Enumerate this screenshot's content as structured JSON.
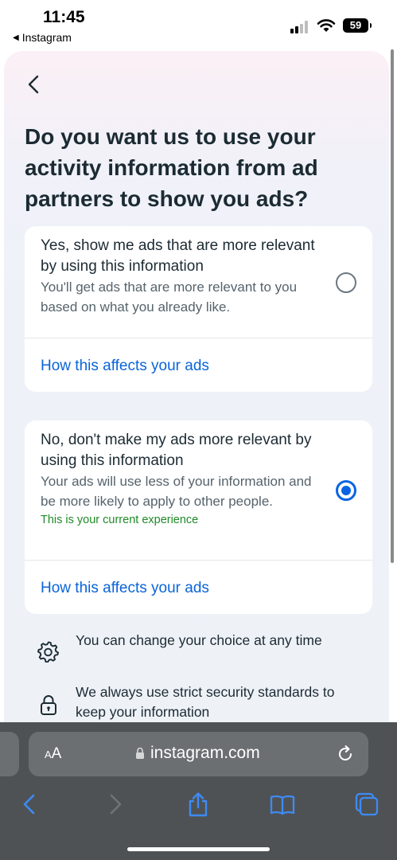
{
  "status_bar": {
    "time": "11:45",
    "back_app": "Instagram",
    "back_arrow": "◀",
    "battery": "59"
  },
  "page": {
    "title": "Do you want us to use your activity information from ad partners to show you ads?",
    "options": [
      {
        "title": "Yes, show me ads that are more relevant by using this information",
        "description": "You'll get ads that are more relevant to you based on what you already like.",
        "selected": false,
        "link": "How this affects your ads"
      },
      {
        "title": "No, don't make my ads more relevant by using this information",
        "description": "Your ads will use less of your information and be more likely to apply to other people.",
        "current_note": "This is your current experience",
        "selected": true,
        "link": "How this affects your ads"
      }
    ],
    "info": [
      {
        "icon": "gear-icon",
        "text": "You can change your choice at any time"
      },
      {
        "icon": "lock-icon",
        "text": "We always use strict security standards to keep your information"
      }
    ]
  },
  "browser": {
    "text_size_label_small": "A",
    "text_size_label_large": "A",
    "url": "instagram.com"
  },
  "colors": {
    "accent": "#0a64d8",
    "current_green": "#1f8a27",
    "text_primary": "#1c2b33",
    "toolbar_bg": "#4f5255"
  }
}
